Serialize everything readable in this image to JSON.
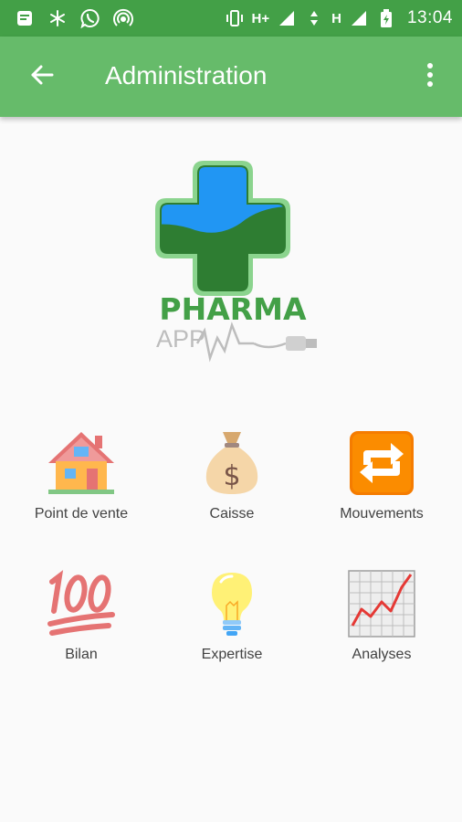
{
  "status_bar": {
    "network_1": "H+",
    "network_2": "H",
    "time": "13:04",
    "icons": [
      "message-icon",
      "snowflake-icon",
      "whatsapp-icon",
      "hotspot-icon",
      "vibrate-icon",
      "signal-icon",
      "battery-icon"
    ]
  },
  "app_bar": {
    "title": "Administration",
    "back_icon": "arrow-left-icon",
    "menu_icon": "more-vert-icon",
    "background": "#66bb6a"
  },
  "logo": {
    "brand": "PHARMA",
    "sub": "APP"
  },
  "menu": {
    "items": [
      {
        "label": "Point de vente",
        "icon": "house-icon"
      },
      {
        "label": "Caisse",
        "icon": "money-bag-icon"
      },
      {
        "label": "Mouvements",
        "icon": "repeat-icon"
      },
      {
        "label": "Bilan",
        "icon": "hundred-points-icon"
      },
      {
        "label": "Expertise",
        "icon": "light-bulb-icon"
      },
      {
        "label": "Analyses",
        "icon": "chart-increasing-icon"
      }
    ]
  },
  "colors": {
    "status_bar": "#43a047",
    "app_bar": "#66bb6a",
    "background": "#fafafa",
    "label_text": "#424242"
  }
}
